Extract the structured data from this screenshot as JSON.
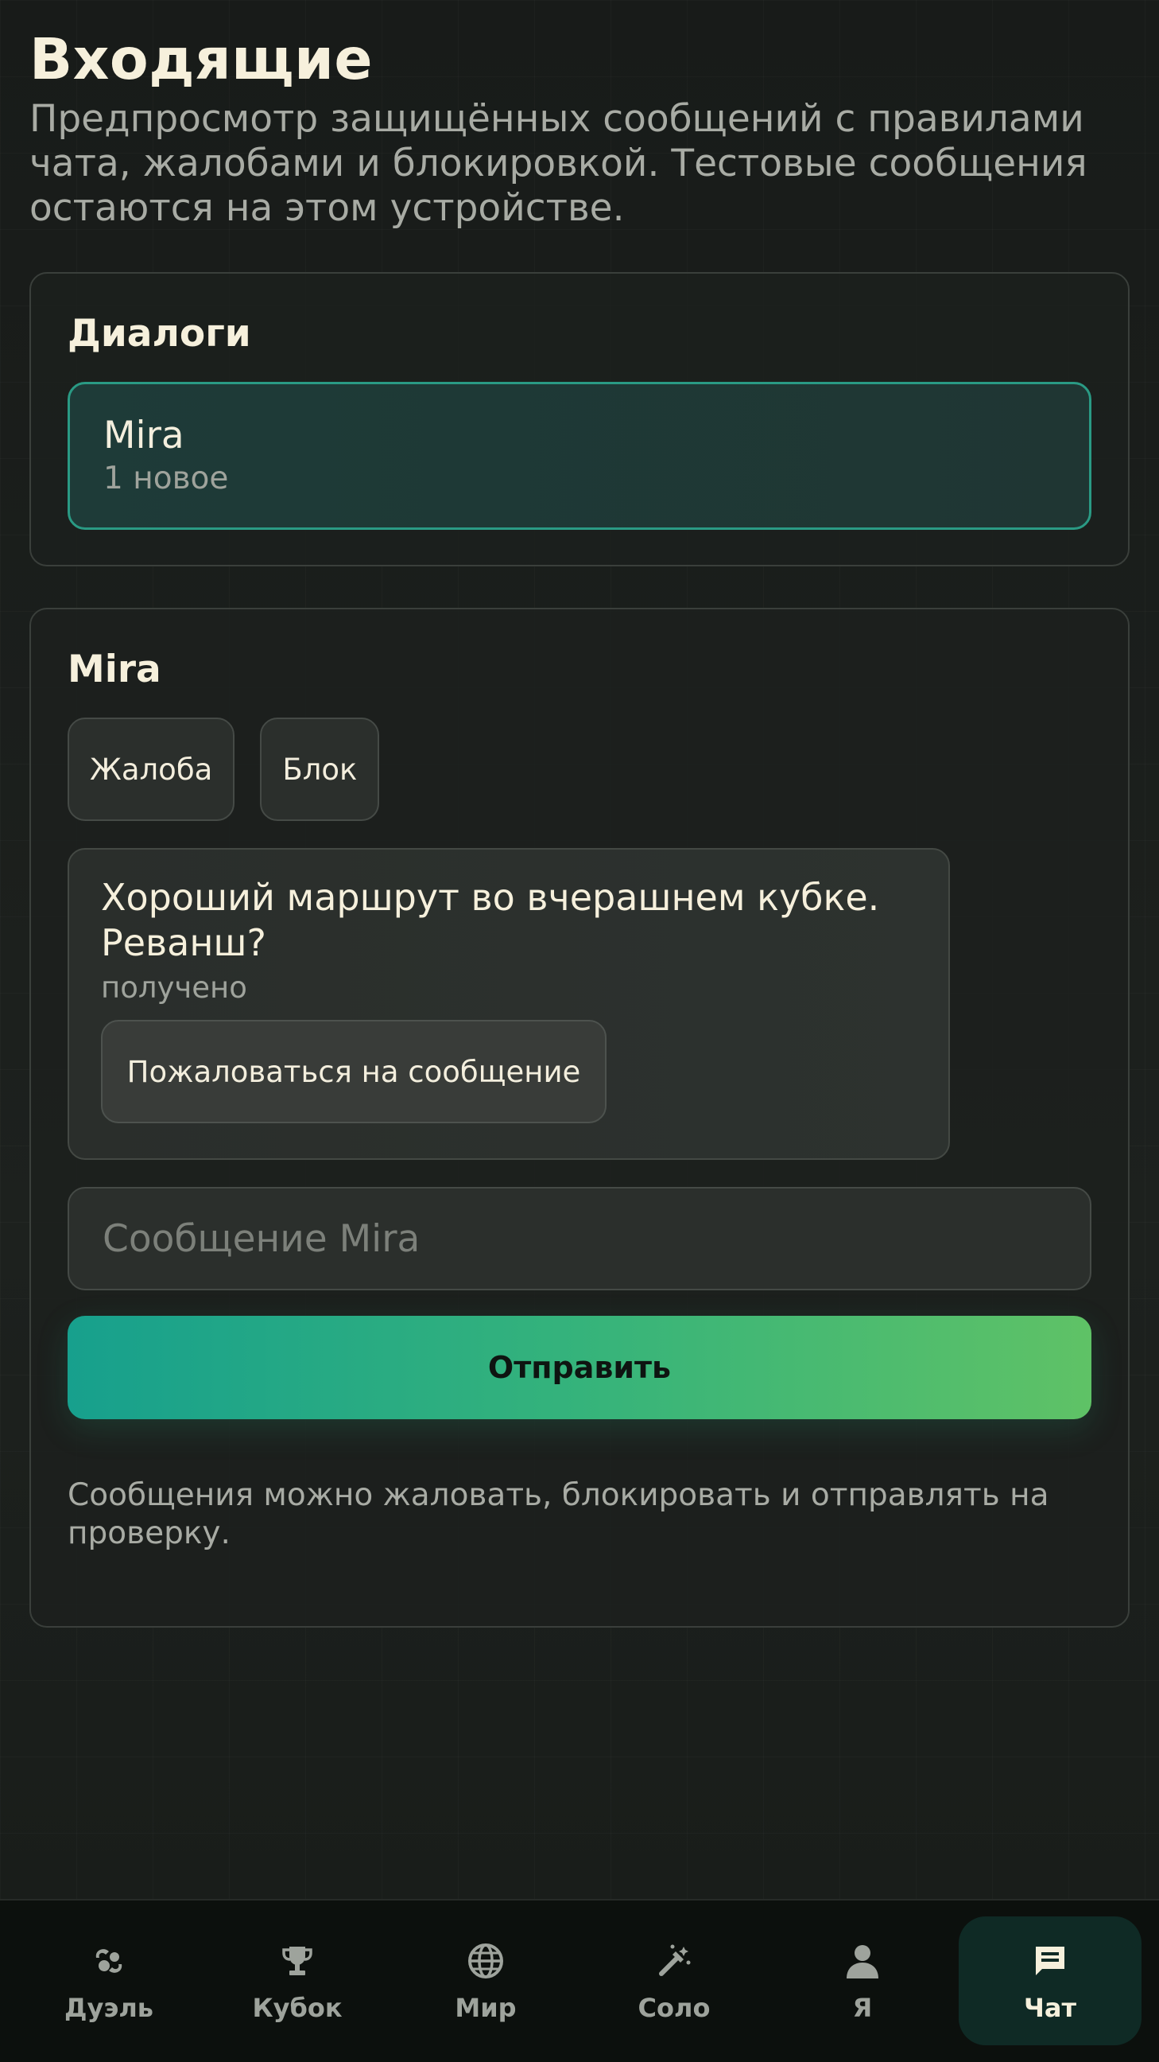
{
  "page": {
    "title": "Входящие",
    "subtitle": "Предпросмотр защищённых сообщений с правилами чата, жалобами и блокировкой. Тестовые сообщения остаются на этом устройстве."
  },
  "dialogs": {
    "title": "Диалоги",
    "items": [
      {
        "name": "Mira",
        "unread": "1 новое",
        "selected": true
      }
    ]
  },
  "chat": {
    "title": "Mira",
    "report_label": "Жалоба",
    "block_label": "Блок",
    "messages": [
      {
        "text": "Хороший маршрут во вчерашнем кубке. Реванш?",
        "status": "получено",
        "report_label": "Пожаловаться на сообщение"
      }
    ],
    "input_placeholder": "Сообщение Mira",
    "send_label": "Отправить",
    "hint": "Сообщения можно жаловать, блокировать и отправлять на проверку."
  },
  "nav": {
    "items": [
      {
        "label": "Дуэль",
        "icon": "duel-icon"
      },
      {
        "label": "Кубок",
        "icon": "trophy-icon"
      },
      {
        "label": "Мир",
        "icon": "globe-icon"
      },
      {
        "label": "Соло",
        "icon": "solo-icon"
      },
      {
        "label": "Я",
        "icon": "person-icon"
      },
      {
        "label": "Чат",
        "icon": "chat-icon",
        "active": true
      }
    ]
  },
  "colors": {
    "background": "#1b1f1c",
    "accent": "#2a9a84",
    "accent_gradient_start": "#17a08d",
    "accent_gradient_end": "#5fc266",
    "text_primary": "#f6f0dc",
    "text_secondary": "#a8aba4"
  }
}
